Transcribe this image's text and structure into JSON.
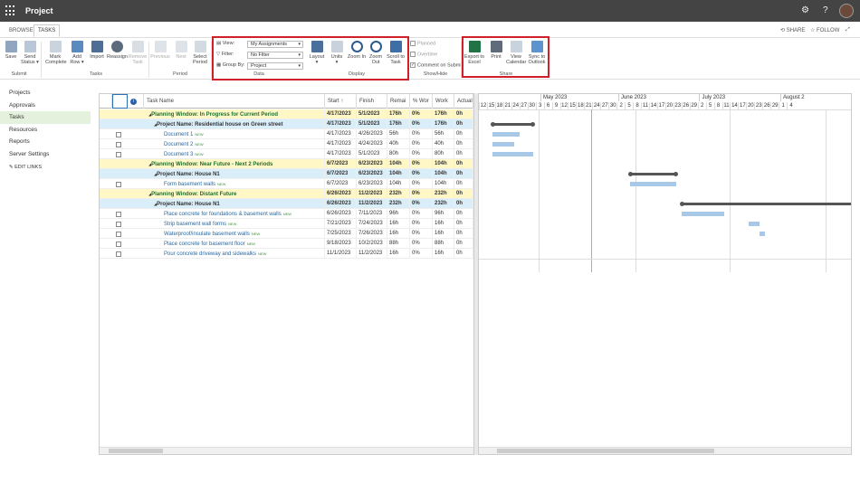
{
  "app": {
    "title": "Project"
  },
  "top_icons": [
    "gear-icon",
    "help-icon"
  ],
  "tabs": [
    {
      "label": "BROWSE"
    },
    {
      "label": "TASKS"
    }
  ],
  "share": "SHARE",
  "follow": "FOLLOW",
  "ribbon": {
    "submit": {
      "save": "Save",
      "send_status": "Send Status ▾",
      "group": "Submit"
    },
    "tasks": {
      "mark_complete": "Mark Complete",
      "add_row": "Add Row ▾",
      "import": "Import",
      "reassign": "Reassign",
      "remove_task": "Remove Task",
      "group": "Tasks"
    },
    "period": {
      "previous": "Previous",
      "next": "Next",
      "select_period": "Select Period",
      "group": "Period"
    },
    "data": {
      "view_label": "View:",
      "view_value": "My Assignments",
      "filter_label": "Filter:",
      "filter_value": "No Filter",
      "groupby_label": "Group By:",
      "groupby_value": "Project",
      "group": "Data"
    },
    "display": {
      "layout": "Layout",
      "units": "Units",
      "zoom_in": "Zoom In",
      "zoom_out": "Zoom Out",
      "scroll_to_task": "Scroll to Task",
      "group": "Display"
    },
    "showhide": {
      "planned": "Planned",
      "overtime": "Overtime",
      "comment": "Comment on Submit",
      "group": "Show/Hide"
    },
    "share": {
      "export_excel": "Export to Excel",
      "print": "Print",
      "view_calendar": "View Calendar",
      "sync_outlook": "Sync to Outlook",
      "group": "Share"
    }
  },
  "nav": {
    "items": [
      "Projects",
      "Approvals",
      "Tasks",
      "Resources",
      "Reports",
      "Server Settings"
    ],
    "edit_links": "EDIT LINKS"
  },
  "columns": [
    "Task Name",
    "Start ↑",
    "Finish",
    "Remai",
    "% Wor",
    "Work",
    "Actual"
  ],
  "rows": [
    {
      "name": "Planning Window: In Progress for Current Period",
      "start": "4/17/2023",
      "finish": "5/1/2023",
      "rem": "176h",
      "pct": "0%",
      "work": "176h",
      "actual": "0h",
      "type": "pw"
    },
    {
      "name": "Project Name: Residential house on Green street",
      "start": "4/17/2023",
      "finish": "5/1/2023",
      "rem": "176h",
      "pct": "0%",
      "work": "176h",
      "actual": "0h",
      "type": "pn"
    },
    {
      "name": "Document 1",
      "start": "4/17/2023",
      "finish": "4/26/2023",
      "rem": "56h",
      "pct": "0%",
      "work": "56h",
      "actual": "0h",
      "type": "task",
      "new": "NEW"
    },
    {
      "name": "Document 2",
      "start": "4/17/2023",
      "finish": "4/24/2023",
      "rem": "40h",
      "pct": "0%",
      "work": "40h",
      "actual": "0h",
      "type": "task",
      "new": "NEW"
    },
    {
      "name": "Document 3",
      "start": "4/17/2023",
      "finish": "5/1/2023",
      "rem": "80h",
      "pct": "0%",
      "work": "80h",
      "actual": "0h",
      "type": "task",
      "new": "NEW"
    },
    {
      "name": "Planning Window: Near Future - Next 2 Periods",
      "start": "6/7/2023",
      "finish": "6/23/2023",
      "rem": "104h",
      "pct": "0%",
      "work": "104h",
      "actual": "0h",
      "type": "pw"
    },
    {
      "name": "Project Name: House N1",
      "start": "6/7/2023",
      "finish": "6/23/2023",
      "rem": "104h",
      "pct": "0%",
      "work": "104h",
      "actual": "0h",
      "type": "pn"
    },
    {
      "name": "Form basement walls",
      "start": "6/7/2023",
      "finish": "6/23/2023",
      "rem": "104h",
      "pct": "0%",
      "work": "104h",
      "actual": "0h",
      "type": "task",
      "new": "NEW"
    },
    {
      "name": "Planning Window: Distant Future",
      "start": "6/26/2023",
      "finish": "11/2/2023",
      "rem": "232h",
      "pct": "0%",
      "work": "232h",
      "actual": "0h",
      "type": "pw"
    },
    {
      "name": "Project Name: House N1",
      "start": "6/26/2023",
      "finish": "11/2/2023",
      "rem": "232h",
      "pct": "0%",
      "work": "232h",
      "actual": "0h",
      "type": "pn"
    },
    {
      "name": "Place concrete for foundations & basement walls",
      "start": "6/26/2023",
      "finish": "7/11/2023",
      "rem": "96h",
      "pct": "0%",
      "work": "96h",
      "actual": "0h",
      "type": "task",
      "new": "NEW"
    },
    {
      "name": "Strip basement wall forms",
      "start": "7/21/2023",
      "finish": "7/24/2023",
      "rem": "16h",
      "pct": "0%",
      "work": "16h",
      "actual": "0h",
      "type": "task",
      "new": "NEW"
    },
    {
      "name": "Waterproof/insulate basement walls",
      "start": "7/25/2023",
      "finish": "7/26/2023",
      "rem": "16h",
      "pct": "0%",
      "work": "16h",
      "actual": "0h",
      "type": "task",
      "new": "NEW"
    },
    {
      "name": "Place concrete for basement floor",
      "start": "9/18/2023",
      "finish": "10/2/2023",
      "rem": "88h",
      "pct": "0%",
      "work": "88h",
      "actual": "0h",
      "type": "task",
      "new": "NEW"
    },
    {
      "name": "Pour concrete driveway and sidewalks",
      "start": "11/1/2023",
      "finish": "11/2/2023",
      "rem": "16h",
      "pct": "0%",
      "work": "16h",
      "actual": "0h",
      "type": "task",
      "new": "NEW"
    }
  ],
  "gantt": {
    "months": [
      "May 2023",
      "June 2023",
      "July 2023",
      "August 2"
    ],
    "days": [
      "12",
      "15",
      "18",
      "21",
      "24",
      "27",
      "30",
      "3",
      "6",
      "9",
      "12",
      "15",
      "18",
      "21",
      "24",
      "27",
      "30",
      "2",
      "5",
      "8",
      "11",
      "14",
      "17",
      "20",
      "23",
      "26",
      "29",
      "2",
      "5",
      "8",
      "11",
      "14",
      "17",
      "20",
      "23",
      "26",
      "29",
      "1",
      "4"
    ]
  }
}
